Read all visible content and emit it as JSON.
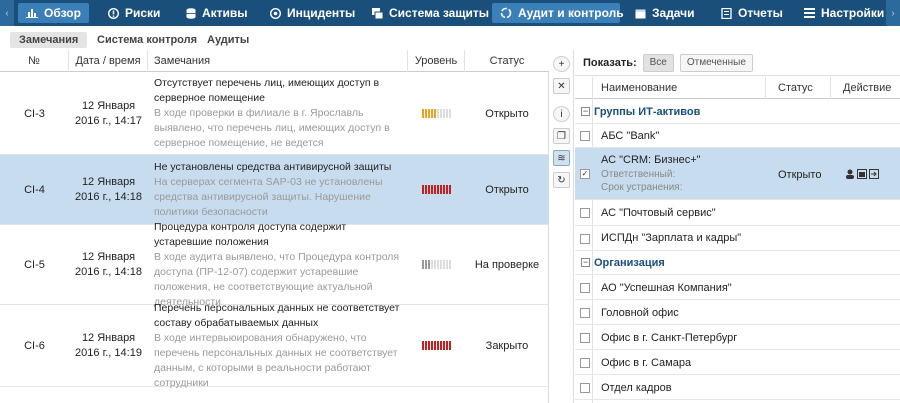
{
  "nav": {
    "items": [
      {
        "label": "Обзор",
        "icon": "bar-chart-icon",
        "active": true
      },
      {
        "label": "Риски",
        "icon": "alert-icon",
        "active": false
      },
      {
        "label": "Активы",
        "icon": "database-icon",
        "active": false
      },
      {
        "label": "Инциденты",
        "icon": "target-icon",
        "active": false
      },
      {
        "label": "Система защиты",
        "icon": "windows-icon",
        "active": false
      },
      {
        "label": "Аудит и контроль",
        "icon": "refresh-icon",
        "active": true
      },
      {
        "label": "Задачи",
        "icon": "calendar-icon",
        "active": false
      },
      {
        "label": "Отчеты",
        "icon": "report-icon",
        "active": false
      },
      {
        "label": "Настройки",
        "icon": "menu-icon",
        "active": false
      }
    ]
  },
  "subtabs": [
    {
      "label": "Замечания",
      "active": true
    },
    {
      "label": "Система контроля",
      "active": false
    },
    {
      "label": "Аудиты",
      "active": false
    }
  ],
  "table": {
    "headers": [
      "№",
      "Дата / время",
      "Замечания",
      "Уровень",
      "Статус"
    ],
    "rows": [
      {
        "id": "CI-3",
        "date": "12 Января",
        "time": "2016 г., 14:17",
        "title": "Отсутствует перечень лиц, имеющих доступ в серверное помещение",
        "desc": "В ходе проверки в филиале в г. Ярославль выявлено, что перечень лиц, имеющих доступ в серверное помещение, не ведется",
        "level": 0.5,
        "level_color": "#f0a020",
        "status": "Открыто",
        "selected": false
      },
      {
        "id": "CI-4",
        "date": "12 Января",
        "time": "2016 г., 14:18",
        "title": "Не установлены средства антивирусной защиты",
        "desc": "На серверах сегмента SAP-03 не установлены средства антивирусной защиты. Нарушение политики безопасности",
        "level": 1.0,
        "level_color": "#c81e1e",
        "status": "Открыто",
        "selected": true
      },
      {
        "id": "CI-5",
        "date": "12 Января",
        "time": "2016 г., 14:18",
        "title": "Процедура контроля доступа содержит устаревшие положения",
        "desc": "В ходе аудита выявлено, что Процедура контроля доступа (ПР-12-07) содержит устаревшие положения, не соответствующие актуальной деятельности",
        "level": 0.25,
        "level_color": "#999999",
        "status": "На проверке",
        "selected": false
      },
      {
        "id": "CI-6",
        "date": "12 Января",
        "time": "2016 г., 14:19",
        "title": "Перечень персональных данных не соответствует составу обрабатываемых данных",
        "desc": "В ходе интервьюирования обнаружено, что перечень персональных данных не соответствует данным, с которыми в реальности работают сотрудники",
        "level": 1.0,
        "level_color": "#c81e1e",
        "status": "Закрыто",
        "selected": false
      }
    ]
  },
  "tools": [
    "plus-icon",
    "close-icon",
    "info-icon",
    "copy-icon",
    "database-icon",
    "comment-refresh-icon"
  ],
  "right": {
    "show_label": "Показать:",
    "filter_all": "Все",
    "filter_marked": "Отмеченные",
    "headers": [
      "Наименование",
      "Статус",
      "Действие"
    ],
    "groups": [
      {
        "name": "Группы ИТ-активов",
        "items": [
          {
            "name": "АБС \"Bank\"",
            "checked": false
          },
          {
            "name": "АС \"CRM: Бизнес+\"",
            "checked": true,
            "selected": true,
            "responsible": "Ответственный:",
            "deadline": "Срок устранения:",
            "status": "Открыто"
          },
          {
            "name": "АС \"Почтовый сервис\"",
            "checked": false
          },
          {
            "name": "ИСПДн \"Зарплата и кадры\"",
            "checked": false
          }
        ]
      },
      {
        "name": "Организация",
        "items": [
          {
            "name": "АО \"Успешная Компания\"",
            "checked": false
          },
          {
            "name": "Головной офис",
            "checked": false
          },
          {
            "name": "Офис в г. Санкт-Петербург",
            "checked": false
          },
          {
            "name": "Офис в г. Самара",
            "checked": false
          },
          {
            "name": "Отдел кадров",
            "checked": false
          }
        ]
      }
    ]
  }
}
